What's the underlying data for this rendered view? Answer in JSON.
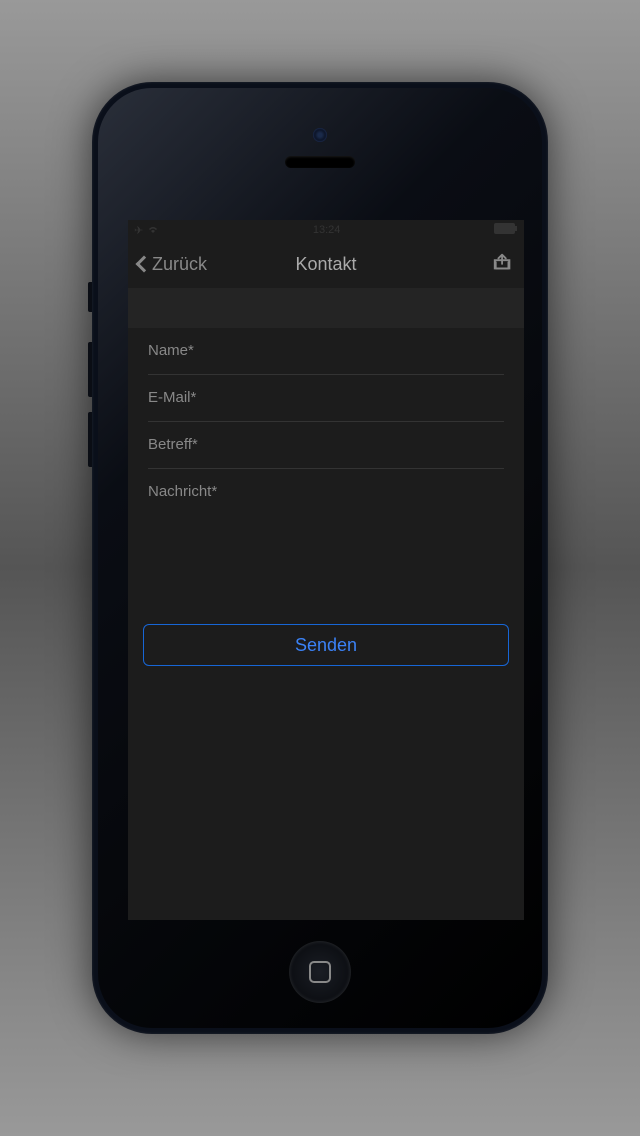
{
  "status": {
    "time": "13:24"
  },
  "nav": {
    "back_label": "Zurück",
    "title": "Kontakt"
  },
  "form": {
    "name_placeholder": "Name*",
    "email_placeholder": "E-Mail*",
    "subject_placeholder": "Betreff*",
    "message_placeholder": "Nachricht*",
    "name_value": "",
    "email_value": "",
    "subject_value": "",
    "message_value": ""
  },
  "actions": {
    "send_label": "Senden"
  }
}
